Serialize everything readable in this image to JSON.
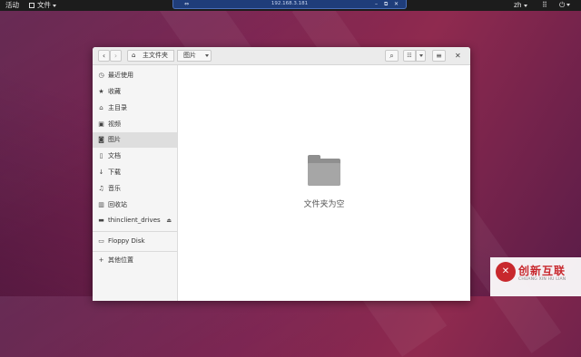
{
  "topbar": {
    "activities": "活动",
    "app_menu": "文件",
    "language": "zh",
    "network_icon": "network-icon",
    "power_icon": "power-icon"
  },
  "remote_bar": {
    "address": "192.168.3.181"
  },
  "window": {
    "breadcrumb_home": "主文件夹",
    "breadcrumb_current": "图片",
    "empty_message": "文件夹为空"
  },
  "sidebar": {
    "items": [
      {
        "label": "最近使用",
        "icon": "clock-icon"
      },
      {
        "label": "收藏",
        "icon": "star-icon"
      },
      {
        "label": "主目录",
        "icon": "home-icon"
      },
      {
        "label": "视频",
        "icon": "video-icon"
      },
      {
        "label": "图片",
        "icon": "camera-icon"
      },
      {
        "label": "文档",
        "icon": "document-icon"
      },
      {
        "label": "下载",
        "icon": "download-icon"
      },
      {
        "label": "音乐",
        "icon": "music-icon"
      },
      {
        "label": "回收站",
        "icon": "trash-icon"
      },
      {
        "label": "thinclient_drives",
        "icon": "drive-icon"
      },
      {
        "label": "Floppy Disk",
        "icon": "drive-icon"
      },
      {
        "label": "其他位置",
        "icon": "plus-icon"
      }
    ]
  },
  "watermark": {
    "name_cn": "创新互联",
    "name_en": "CHUANG XIN HU LIAN"
  }
}
